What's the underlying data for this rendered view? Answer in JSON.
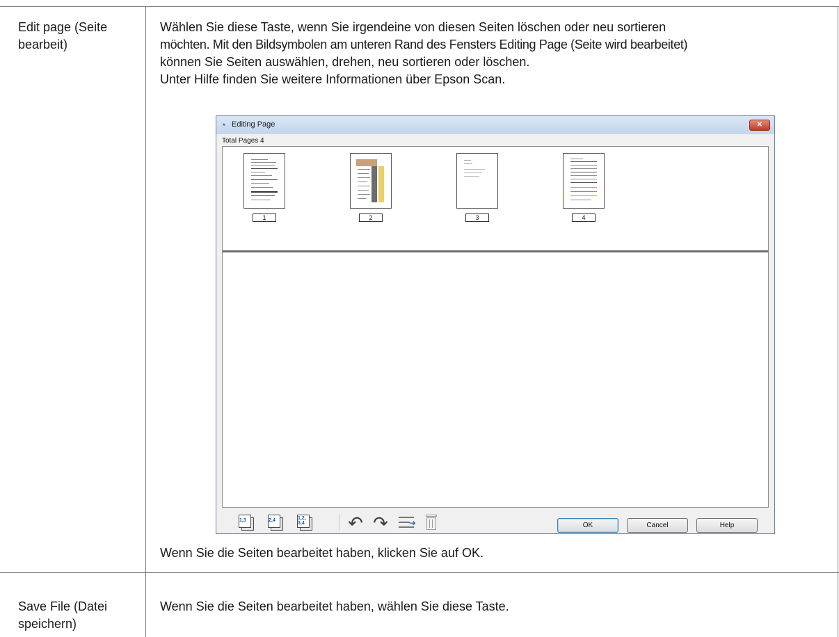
{
  "rows": [
    {
      "label_lines": [
        "Edit page (Seite",
        "bearbeit)"
      ],
      "desc_lines": [
        "Wählen Sie diese Taste, wenn Sie irgendeine von diesen Seiten löschen oder neu sortieren",
        "möchten. Mit den Bildsymbolen am unteren Rand des Fensters Editing Page (Seite wird bearbeitet)",
        "können Sie Seiten auswählen, drehen, neu sortieren oder löschen.",
        "Unter Hilfe finden Sie weitere Informationen über Epson Scan."
      ],
      "after_text": "Wenn Sie die Seiten bearbeitet haben, klicken Sie auf OK."
    },
    {
      "label_lines": [
        "Save File (Datei",
        "speichern)"
      ],
      "desc": "Wenn Sie die Seiten bearbeitet haben, wählen Sie diese Taste."
    }
  ],
  "window": {
    "title": "Editing Page",
    "close_glyph": "✕",
    "total_pages_label": "Total Pages 4",
    "pages": [
      "1",
      "2",
      "3",
      "4"
    ],
    "toolbar_icons": [
      {
        "name": "select-odd-pages-icon",
        "label": "1,3"
      },
      {
        "name": "select-even-pages-icon",
        "label": "2,4"
      },
      {
        "name": "select-all-pages-icon",
        "label": "1,2, 3,4"
      },
      {
        "name": "rotate-left-icon"
      },
      {
        "name": "rotate-right-icon"
      },
      {
        "name": "reorder-pages-icon"
      },
      {
        "name": "delete-page-icon"
      }
    ],
    "buttons": {
      "ok": "OK",
      "cancel": "Cancel",
      "help": "Help"
    },
    "accent_color": "#3c7fb1"
  }
}
